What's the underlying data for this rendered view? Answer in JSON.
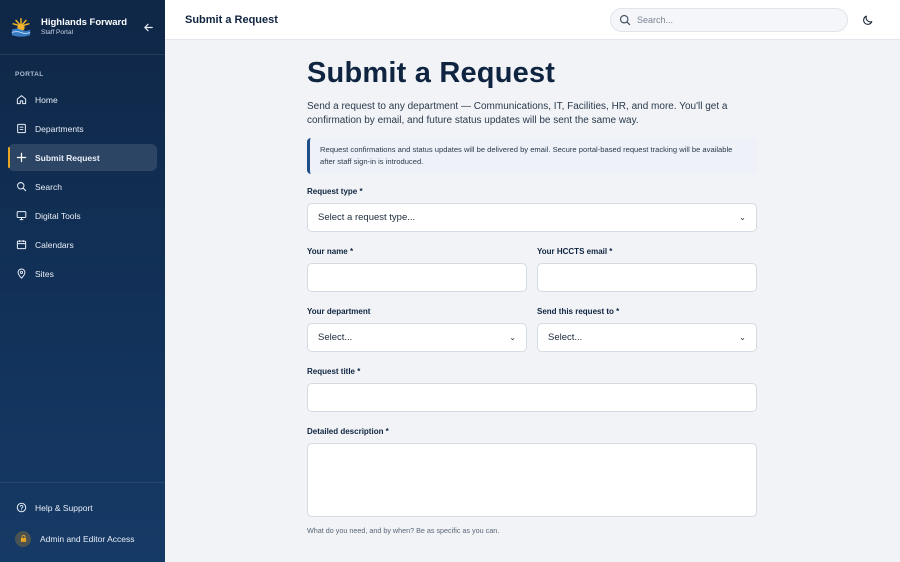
{
  "brand": {
    "title": "Highlands Forward",
    "subtitle": "Staff Portal"
  },
  "sidebar": {
    "section_label": "PORTAL",
    "items": [
      {
        "label": "Home",
        "icon": "home-icon"
      },
      {
        "label": "Departments",
        "icon": "departments-icon"
      },
      {
        "label": "Submit Request",
        "icon": "plus-icon",
        "active": true
      },
      {
        "label": "Search",
        "icon": "search-icon"
      },
      {
        "label": "Digital Tools",
        "icon": "monitor-icon"
      },
      {
        "label": "Calendars",
        "icon": "calendar-icon"
      },
      {
        "label": "Sites",
        "icon": "map-pin-icon"
      }
    ],
    "bottom": [
      {
        "label": "Help & Support",
        "icon": "help-icon"
      },
      {
        "label": "Admin and Editor Access",
        "icon": "lock-icon"
      }
    ]
  },
  "topbar": {
    "title": "Submit a Request",
    "search_placeholder": "Search..."
  },
  "page": {
    "heading": "Submit a Request",
    "intro": "Send a request to any department — Communications, IT, Facilities, HR, and more. You'll get a confirmation by email, and future status updates will be sent the same way.",
    "notice": "Request confirmations and status updates will be delivered by email. Secure portal-based request tracking will be available after staff sign-in is introduced."
  },
  "form": {
    "request_type": {
      "label": "Request type *",
      "value": "Select a request type..."
    },
    "name": {
      "label": "Your name *",
      "value": ""
    },
    "email": {
      "label": "Your HCCTS email *",
      "value": ""
    },
    "department": {
      "label": "Your department",
      "value": "Select..."
    },
    "send_to": {
      "label": "Send this request to *",
      "value": "Select..."
    },
    "title": {
      "label": "Request title *",
      "value": ""
    },
    "description": {
      "label": "Detailed description *",
      "value": "",
      "help": "What do you need, and by when? Be as specific as you can."
    }
  },
  "colors": {
    "sidebar_bg": "#12325a",
    "accent": "#e6a522",
    "primary": "#0f2440"
  }
}
